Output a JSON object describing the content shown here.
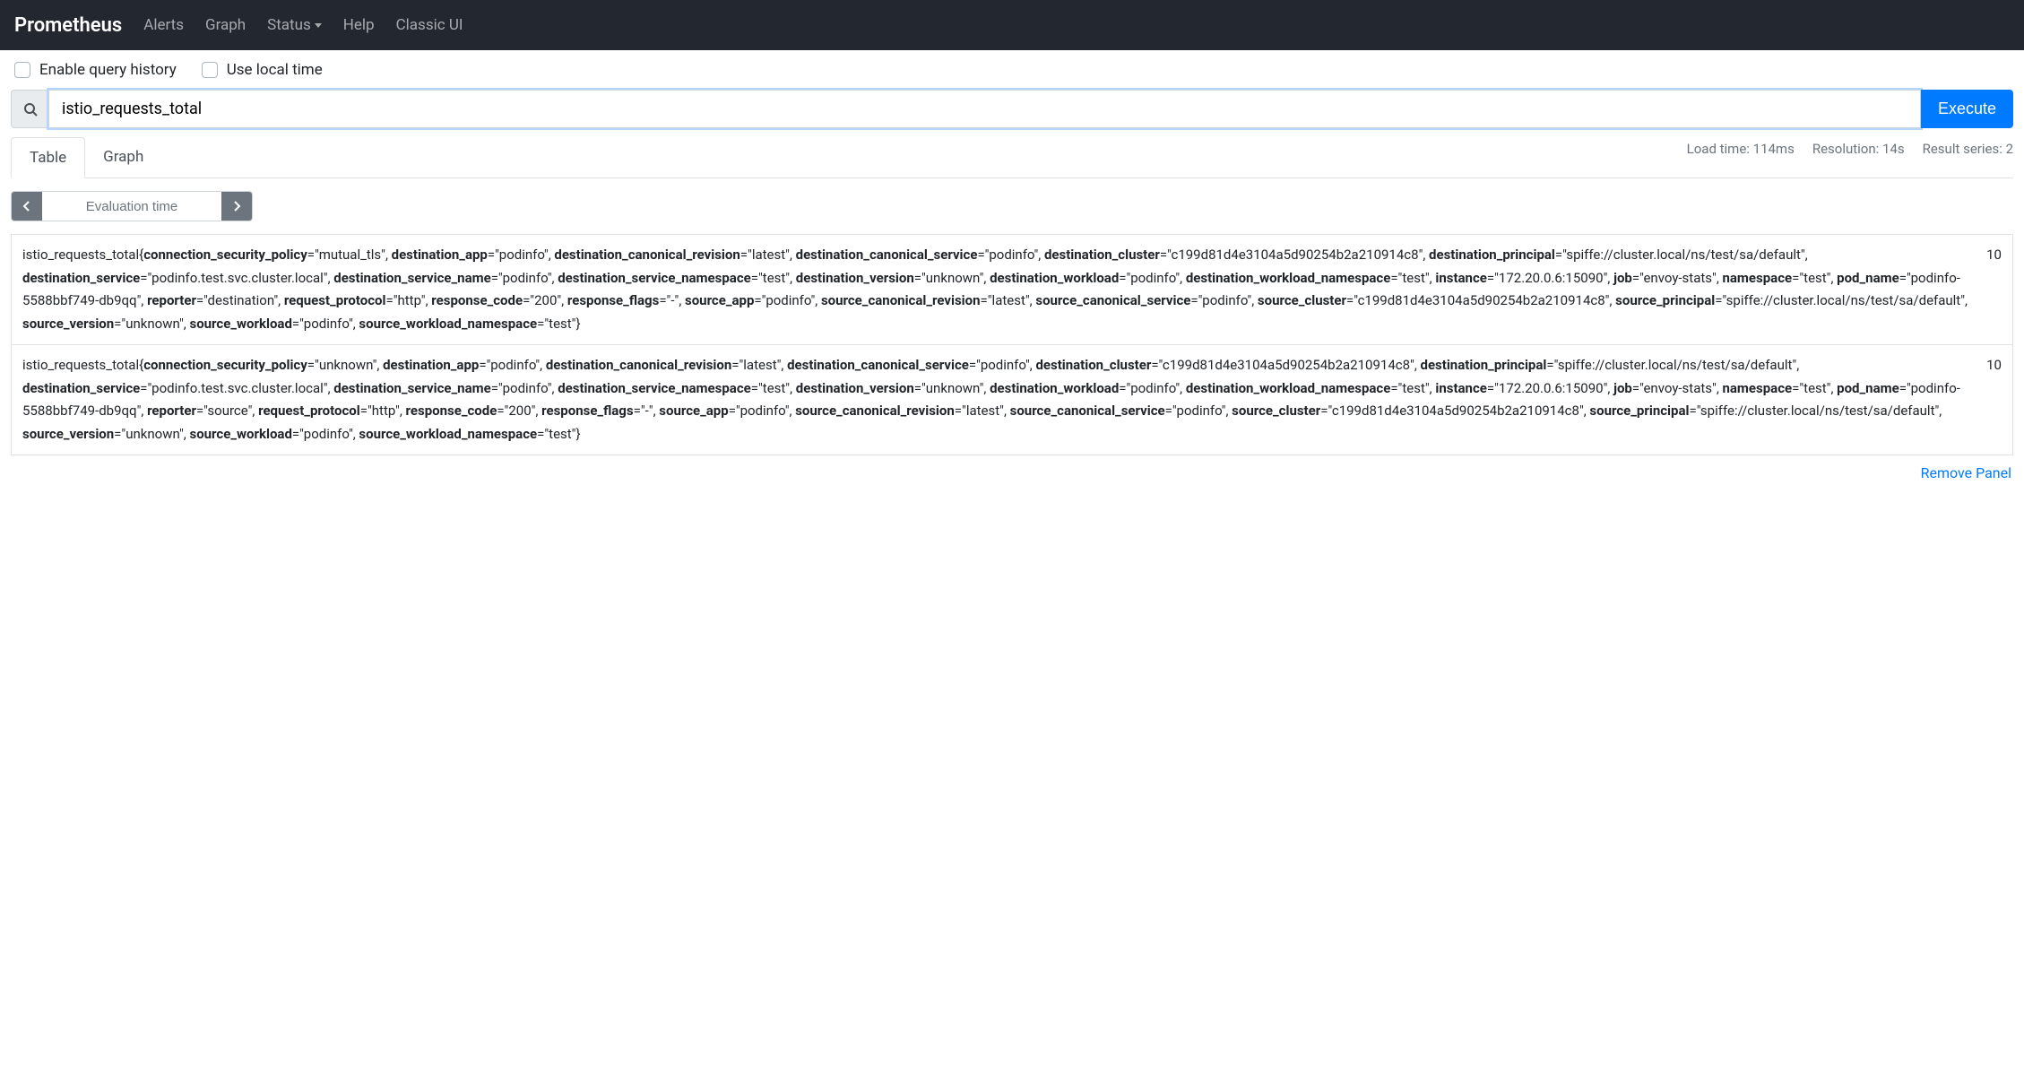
{
  "nav": {
    "brand": "Prometheus",
    "items": [
      "Alerts",
      "Graph",
      "Status",
      "Help",
      "Classic UI"
    ]
  },
  "options": {
    "history_label": "Enable query history",
    "localtime_label": "Use local time"
  },
  "query": {
    "value": "istio_requests_total",
    "execute_label": "Execute"
  },
  "tabs": {
    "table": "Table",
    "graph": "Graph"
  },
  "status": {
    "load": "Load time: 114ms",
    "resolution": "Resolution: 14s",
    "series": "Result series: 2"
  },
  "eval": {
    "placeholder": "Evaluation time"
  },
  "results": [
    {
      "metric": "istio_requests_total",
      "value": "10",
      "labels": [
        {
          "k": "connection_security_policy",
          "v": "mutual_tls"
        },
        {
          "k": "destination_app",
          "v": "podinfo"
        },
        {
          "k": "destination_canonical_revision",
          "v": "latest"
        },
        {
          "k": "destination_canonical_service",
          "v": "podinfo"
        },
        {
          "k": "destination_cluster",
          "v": "c199d81d4e3104a5d90254b2a210914c8"
        },
        {
          "k": "destination_principal",
          "v": "spiffe://cluster.local/ns/test/sa/default"
        },
        {
          "k": "destination_service",
          "v": "podinfo.test.svc.cluster.local"
        },
        {
          "k": "destination_service_name",
          "v": "podinfo"
        },
        {
          "k": "destination_service_namespace",
          "v": "test"
        },
        {
          "k": "destination_version",
          "v": "unknown"
        },
        {
          "k": "destination_workload",
          "v": "podinfo"
        },
        {
          "k": "destination_workload_namespace",
          "v": "test"
        },
        {
          "k": "instance",
          "v": "172.20.0.6:15090"
        },
        {
          "k": "job",
          "v": "envoy-stats"
        },
        {
          "k": "namespace",
          "v": "test"
        },
        {
          "k": "pod_name",
          "v": "podinfo-5588bbf749-db9qq"
        },
        {
          "k": "reporter",
          "v": "destination"
        },
        {
          "k": "request_protocol",
          "v": "http"
        },
        {
          "k": "response_code",
          "v": "200"
        },
        {
          "k": "response_flags",
          "v": "-"
        },
        {
          "k": "source_app",
          "v": "podinfo"
        },
        {
          "k": "source_canonical_revision",
          "v": "latest"
        },
        {
          "k": "source_canonical_service",
          "v": "podinfo"
        },
        {
          "k": "source_cluster",
          "v": "c199d81d4e3104a5d90254b2a210914c8"
        },
        {
          "k": "source_principal",
          "v": "spiffe://cluster.local/ns/test/sa/default"
        },
        {
          "k": "source_version",
          "v": "unknown"
        },
        {
          "k": "source_workload",
          "v": "podinfo"
        },
        {
          "k": "source_workload_namespace",
          "v": "test"
        }
      ]
    },
    {
      "metric": "istio_requests_total",
      "value": "10",
      "labels": [
        {
          "k": "connection_security_policy",
          "v": "unknown"
        },
        {
          "k": "destination_app",
          "v": "podinfo"
        },
        {
          "k": "destination_canonical_revision",
          "v": "latest"
        },
        {
          "k": "destination_canonical_service",
          "v": "podinfo"
        },
        {
          "k": "destination_cluster",
          "v": "c199d81d4e3104a5d90254b2a210914c8"
        },
        {
          "k": "destination_principal",
          "v": "spiffe://cluster.local/ns/test/sa/default"
        },
        {
          "k": "destination_service",
          "v": "podinfo.test.svc.cluster.local"
        },
        {
          "k": "destination_service_name",
          "v": "podinfo"
        },
        {
          "k": "destination_service_namespace",
          "v": "test"
        },
        {
          "k": "destination_version",
          "v": "unknown"
        },
        {
          "k": "destination_workload",
          "v": "podinfo"
        },
        {
          "k": "destination_workload_namespace",
          "v": "test"
        },
        {
          "k": "instance",
          "v": "172.20.0.6:15090"
        },
        {
          "k": "job",
          "v": "envoy-stats"
        },
        {
          "k": "namespace",
          "v": "test"
        },
        {
          "k": "pod_name",
          "v": "podinfo-5588bbf749-db9qq"
        },
        {
          "k": "reporter",
          "v": "source"
        },
        {
          "k": "request_protocol",
          "v": "http"
        },
        {
          "k": "response_code",
          "v": "200"
        },
        {
          "k": "response_flags",
          "v": "-"
        },
        {
          "k": "source_app",
          "v": "podinfo"
        },
        {
          "k": "source_canonical_revision",
          "v": "latest"
        },
        {
          "k": "source_canonical_service",
          "v": "podinfo"
        },
        {
          "k": "source_cluster",
          "v": "c199d81d4e3104a5d90254b2a210914c8"
        },
        {
          "k": "source_principal",
          "v": "spiffe://cluster.local/ns/test/sa/default"
        },
        {
          "k": "source_version",
          "v": "unknown"
        },
        {
          "k": "source_workload",
          "v": "podinfo"
        },
        {
          "k": "source_workload_namespace",
          "v": "test"
        }
      ]
    }
  ],
  "footer": {
    "remove": "Remove Panel"
  }
}
